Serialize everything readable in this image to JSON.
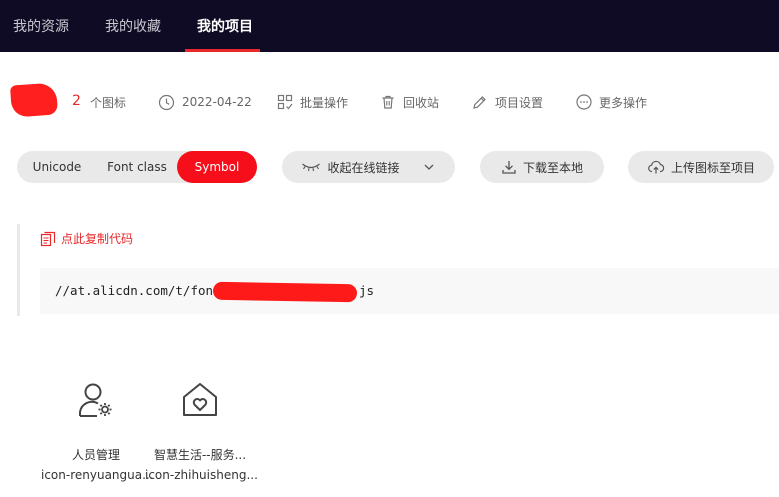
{
  "nav": {
    "tabs": [
      {
        "label": "我的资源"
      },
      {
        "label": "我的收藏"
      },
      {
        "label": "我的项目"
      }
    ]
  },
  "colors": {
    "accent": "#f60f1a",
    "topbar": "#0f0b24",
    "pill_bg": "#e9e9e9"
  },
  "project": {
    "icon_count": "2",
    "icon_count_unit": "个图标",
    "date": "2022-04-22",
    "batch_ops": "批量操作",
    "recycle_bin": "回收站",
    "settings": "项目设置",
    "more_ops": "更多操作"
  },
  "format_tabs": [
    "Unicode",
    "Font class",
    "Symbol"
  ],
  "format_selected": "Symbol",
  "actions": {
    "collapse_link": "收起在线链接",
    "download_local": "下载至本地",
    "upload_icons": "上传图标至项目"
  },
  "code": {
    "copy_label": "点此复制代码",
    "url_prefix": "//at.alicdn.com/t/font",
    "url_suffix": "js"
  },
  "icons": [
    {
      "name": "人员管理",
      "code": "icon-renyuangua...",
      "icon": "user-gear-icon"
    },
    {
      "name": "智慧生活--服务...",
      "code": "icon-zhihuisheng...",
      "icon": "house-heart-icon"
    }
  ]
}
